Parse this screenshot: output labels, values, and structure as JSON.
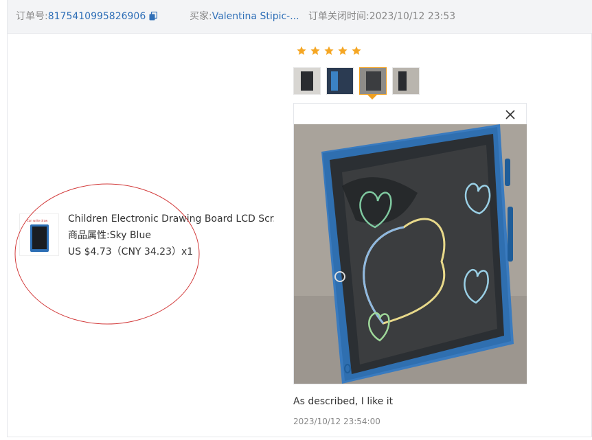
{
  "header": {
    "order_no_label": "订单号:",
    "order_no": "8175410995826906",
    "buyer_label": "买家:",
    "buyer_name": "Valentina Stipic-...",
    "close_time_label": "订单关闭时间:",
    "close_time": "2023/10/12 23:53"
  },
  "product": {
    "thumb_caption": "Can write draw",
    "title": "Children Electronic Drawing Board LCD Scr...",
    "attr_label": "商品属性:",
    "attr_value": "Sky Blue",
    "price": "US $4.73（CNY  34.23）x1"
  },
  "review": {
    "rating": 5,
    "thumbnails": [
      "photo-1",
      "photo-2",
      "photo-3",
      "photo-4"
    ],
    "selected_index": 2,
    "text": "As described, I like it",
    "time": "2023/10/12 23:54:00"
  },
  "colors": {
    "link": "#2f6fb7",
    "star": "#f5a623",
    "selected_border": "#f0a020",
    "annotation": "#d23a3a"
  },
  "icons": {
    "copy": "copy-icon",
    "star": "star-icon",
    "close": "close-icon"
  }
}
